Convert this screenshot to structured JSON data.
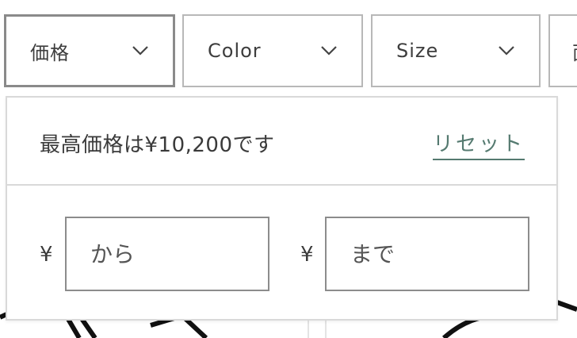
{
  "filters": {
    "price_label": "価格",
    "color_label": "Color",
    "size_label": "Size",
    "partial_label": "面"
  },
  "price_panel": {
    "max_price_text": "最高価格は¥10,200です",
    "reset_label": "リセット",
    "currency_symbol_from": "¥",
    "currency_symbol_to": "¥",
    "from_placeholder": "から",
    "to_placeholder": "まで"
  }
}
